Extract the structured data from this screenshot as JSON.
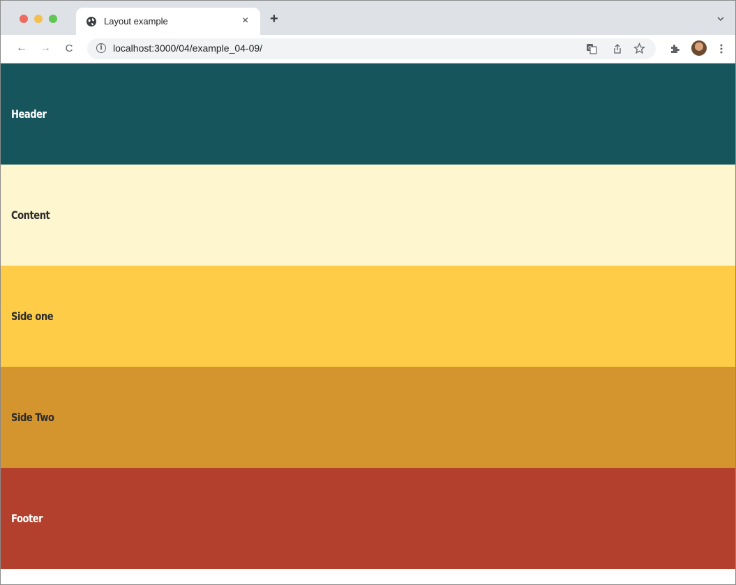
{
  "browser": {
    "tab": {
      "title": "Layout example",
      "close_glyph": "×",
      "icon": "globe-icon"
    },
    "new_tab_glyph": "+",
    "nav": {
      "back_glyph": "←",
      "forward_glyph": "→",
      "reload_glyph": "C"
    },
    "address": {
      "host": "localhost",
      "path": ":3000/04/example_04-09/"
    },
    "toolbar_icons": [
      "translate-icon",
      "share-icon",
      "star-icon",
      "extensions-icon",
      "avatar",
      "menu-icon"
    ]
  },
  "sections": [
    {
      "label": "Header",
      "bg": "#16555c",
      "color": "#ffffff"
    },
    {
      "label": "Content",
      "bg": "#fdf6cf",
      "color": "#2b2b2b"
    },
    {
      "label": "Side one",
      "bg": "#fecc47",
      "color": "#2b2b2b"
    },
    {
      "label": "Side Two",
      "bg": "#d4952f",
      "color": "#2b2b2b"
    },
    {
      "label": "Footer",
      "bg": "#b3402d",
      "color": "#ffffff"
    }
  ]
}
